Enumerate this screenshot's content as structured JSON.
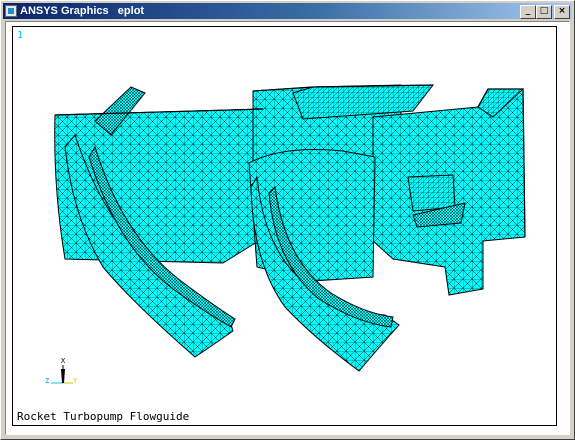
{
  "window": {
    "title": "ANSYS Graphics   eplot",
    "minimize_label": "_",
    "maximize_label": "□",
    "close_label": "×"
  },
  "viewport": {
    "view_number": "1",
    "caption": "Rocket Turbopump Flowguide",
    "mesh_fill_color": "#00ffff",
    "mesh_line_color": "#000000"
  },
  "triad": {
    "x_label": "X",
    "y_label": "Y",
    "z_label": "Z"
  }
}
